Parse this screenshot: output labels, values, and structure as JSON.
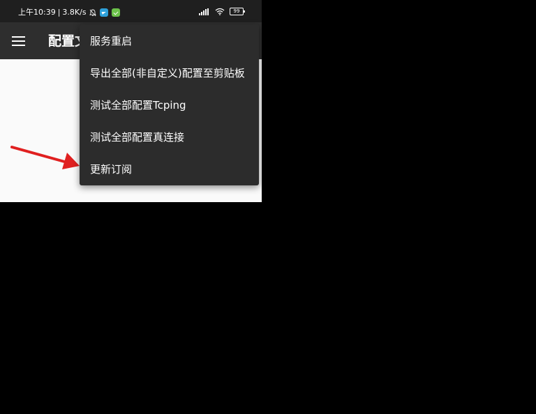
{
  "status_bar": {
    "time": "上午10:39",
    "separator": "|",
    "speed": "3.8K/s",
    "battery": "99",
    "icons": [
      "bell-off-icon",
      "telegram-icon",
      "download-app-icon",
      "signal-icon",
      "wifi-icon",
      "battery-icon"
    ]
  },
  "app_bar": {
    "title": "配置文",
    "menu_icon": "hamburger-menu-icon"
  },
  "menu": {
    "items": [
      {
        "label": "服务重启"
      },
      {
        "label": "导出全部(非自定义)配置至剪贴板"
      },
      {
        "label": "测试全部配置Tcping"
      },
      {
        "label": "测试全部配置真连接"
      },
      {
        "label": "更新订阅"
      }
    ]
  },
  "annotation": {
    "arrow_color": "#e02020",
    "points_to": "更新订阅"
  },
  "colors": {
    "status_bar": "#1f1f1f",
    "app_bar": "#2e2e2e",
    "menu_bg": "#2c2c2c",
    "content_bg": "#fafafa"
  }
}
